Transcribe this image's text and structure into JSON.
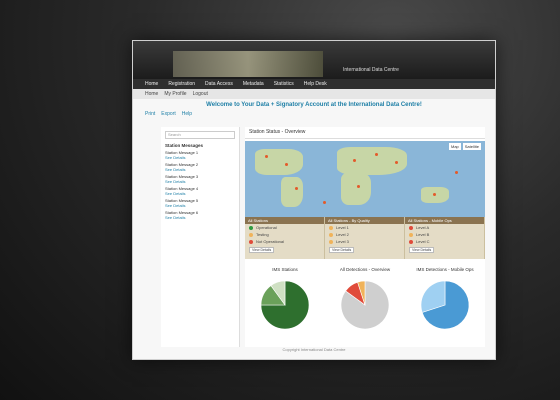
{
  "site": {
    "title": "International Data Centre",
    "nav": [
      "Home",
      "Registration",
      "Data Access",
      "Metadata",
      "Statistics",
      "Help Desk"
    ]
  },
  "subbar": [
    "Home",
    "My Profile",
    "Logout"
  ],
  "welcome": "Welcome to Your Data + Signatory Account at the International Data Centre!",
  "actions": [
    "Print",
    "Export",
    "Help"
  ],
  "sidebar": {
    "search_placeholder": "Search",
    "title": "Station Messages",
    "items": [
      {
        "t": "Station Message 1",
        "s": "See Details"
      },
      {
        "t": "Station Message 2",
        "s": "See Details"
      },
      {
        "t": "Station Message 3",
        "s": "See Details"
      },
      {
        "t": "Station Message 4",
        "s": "See Details"
      },
      {
        "t": "Station Message 5",
        "s": "See Details"
      },
      {
        "t": "Station Message 6",
        "s": "See Details"
      }
    ]
  },
  "main": {
    "panel_title": "Station Status - Overview",
    "map_controls": [
      "Map",
      "Satellite"
    ],
    "legend": [
      {
        "head": "All Stations",
        "rows": [
          "Operational",
          "Testing",
          "Not Operational"
        ],
        "btn": "View Details"
      },
      {
        "head": "All Stations - By Quality",
        "rows": [
          "Level 1",
          "Level 2",
          "Level 3"
        ],
        "btn": "View Details"
      },
      {
        "head": "All Stations - Mobile Ops",
        "rows": [
          "Level A",
          "Level B",
          "Level C"
        ],
        "btn": "View Details"
      }
    ],
    "charts": [
      {
        "title": "IMS Stations",
        "slices": [
          0.75,
          0.15,
          0.1
        ],
        "colors": [
          "#2e6f2e",
          "#6aa15a",
          "#cfe0c3"
        ]
      },
      {
        "title": "All Detections - Overview",
        "slices": [
          0.85,
          0.1,
          0.05
        ],
        "colors": [
          "#cfcfcf",
          "#e04b3a",
          "#f0b35a"
        ]
      },
      {
        "title": "IMS Detections - Mobile Ops",
        "slices": [
          0.7,
          0.3
        ],
        "colors": [
          "#4a9ad4",
          "#9fd0f2"
        ]
      }
    ]
  },
  "footer": "Copyright International Data Centre"
}
